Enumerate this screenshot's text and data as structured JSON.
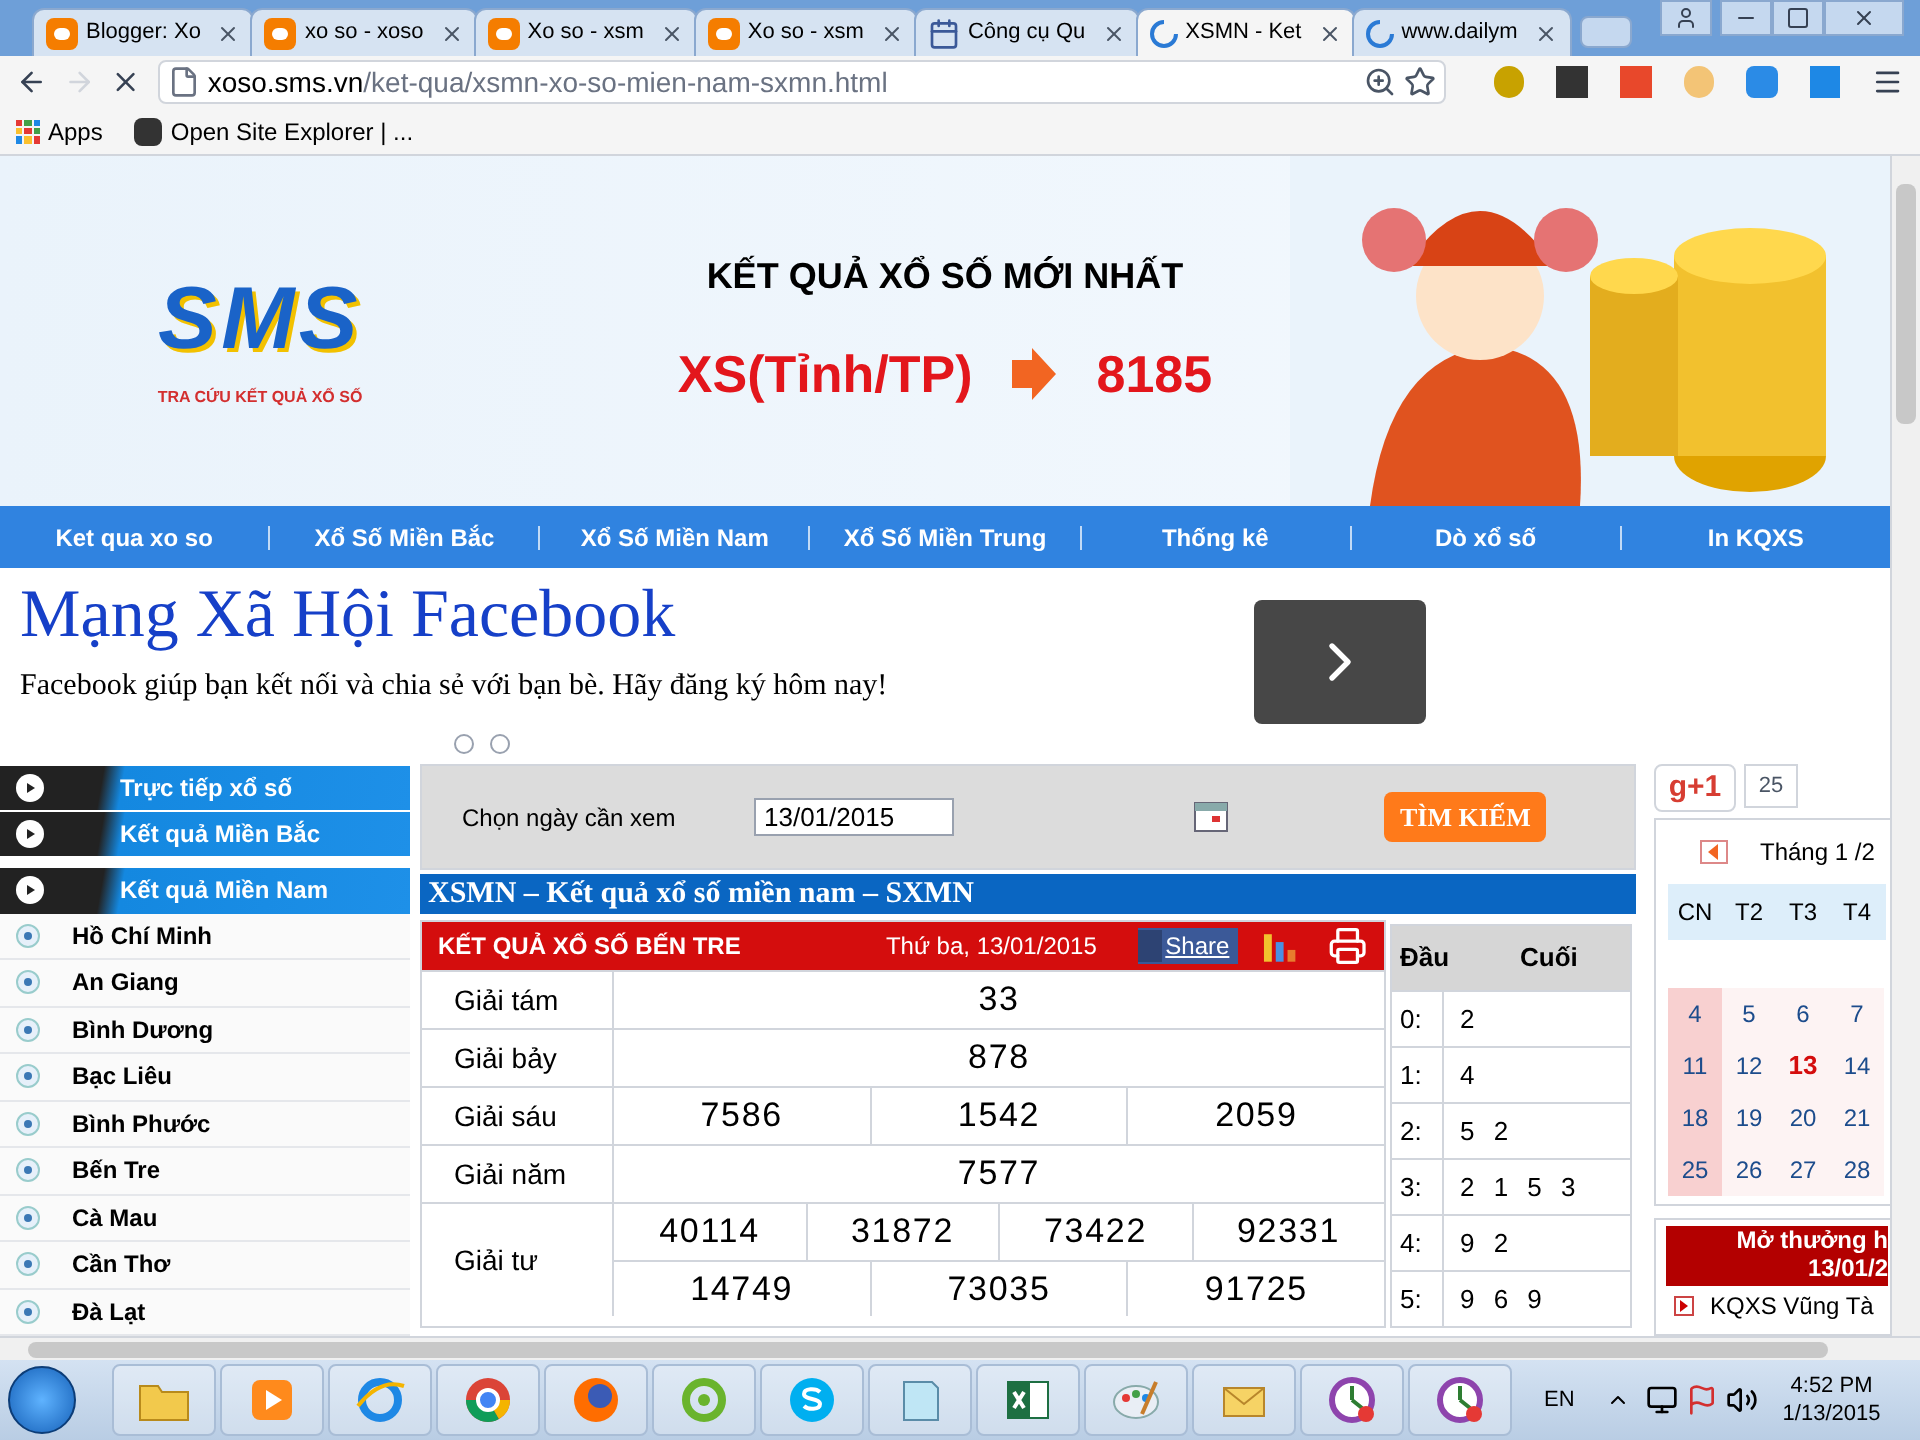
{
  "browser": {
    "tabs": [
      {
        "title": "Blogger: Xo",
        "kind": "blogger",
        "selected": false
      },
      {
        "title": "xo so - xoso",
        "kind": "blogger",
        "selected": false
      },
      {
        "title": "Xo so - xsm",
        "kind": "blogger",
        "selected": false
      },
      {
        "title": "Xo so - xsm",
        "kind": "blogger",
        "selected": false
      },
      {
        "title": "Công cụ Qu",
        "kind": "tool",
        "selected": false
      },
      {
        "title": "XSMN - Ket",
        "kind": "loading",
        "selected": true
      },
      {
        "title": "www.dailym",
        "kind": "loading",
        "selected": false
      }
    ],
    "url_host": "xoso.sms.vn",
    "url_path": "/ket-qua/xsmn-xo-so-mien-nam-sxmn.html",
    "bookmarks": [
      {
        "label": "Apps",
        "kind": "apps"
      },
      {
        "label": "Open Site Explorer | ...",
        "kind": "moz"
      }
    ]
  },
  "banner": {
    "logo": "SMS",
    "tagline": "TRA CỨU KẾT QUẢ XỔ SỐ",
    "headline": "KẾT QUẢ XỔ SỐ MỚI NHẤT",
    "syntax": "XS(Tỉnh/TP)",
    "number": "8185"
  },
  "nav": [
    "Ket qua xo so",
    "Xổ Số Miền Bắc",
    "Xổ Số Miền Nam",
    "Xổ Số Miền Trung",
    "Thống kê",
    "Dò xổ số",
    "In KQXS"
  ],
  "facebook_ad": {
    "title": "Mạng Xã Hội Facebook",
    "text": "Facebook giúp bạn kết nối và chia sẻ với bạn bè. Hãy đăng ký hôm nay!"
  },
  "sidebar": {
    "sections": [
      "Trực tiếp xổ số",
      "Kết quả Miền Bắc",
      "Kết quả Miền Nam"
    ],
    "provinces": [
      "Hồ Chí Minh",
      "An Giang",
      "Bình Dương",
      "Bạc Liêu",
      "Bình Phước",
      "Bến Tre",
      "Cà Mau",
      "Cần Thơ",
      "Đà Lạt"
    ]
  },
  "search": {
    "label": "Chọn ngày cần xem",
    "date": "13/01/2015",
    "button": "TÌM KIẾM"
  },
  "results_title": "XSMN – Kết quả xổ số miền nam – SXMN",
  "results": {
    "title": "KẾT QUẢ XỔ SỐ BẾN TRE",
    "date": "Thứ ba, 13/01/2015",
    "share": "Share",
    "prizes": [
      {
        "name": "Giải tám",
        "lines": [
          [
            "33"
          ]
        ]
      },
      {
        "name": "Giải bảy",
        "lines": [
          [
            "878"
          ]
        ]
      },
      {
        "name": "Giải sáu",
        "lines": [
          [
            "7586",
            "1542",
            "2059"
          ]
        ]
      },
      {
        "name": "Giải năm",
        "lines": [
          [
            "7577"
          ]
        ]
      },
      {
        "name": "Giải tư",
        "lines": [
          [
            "40114",
            "31872",
            "73422",
            "92331"
          ],
          [
            "14749",
            "73035",
            "91725"
          ]
        ]
      }
    ]
  },
  "loto": {
    "columns": [
      "Đầu",
      "Cuối"
    ],
    "rows": [
      {
        "head": "0:",
        "tail": "2"
      },
      {
        "head": "1:",
        "tail": "4"
      },
      {
        "head": "2:",
        "tail": "5 2"
      },
      {
        "head": "3:",
        "tail": "2 1 5 3"
      },
      {
        "head": "4:",
        "tail": "9 2"
      },
      {
        "head": "5:",
        "tail": "9 6 9"
      }
    ]
  },
  "social": {
    "plus": "g+1",
    "count": "25"
  },
  "calendar": {
    "month": "Tháng 1 /2",
    "weekdays": [
      "CN",
      "T2",
      "T3",
      "T4"
    ],
    "weeks": [
      [
        {
          "day": "4",
          "selected": false
        },
        {
          "day": "5",
          "selected": false
        },
        {
          "day": "6",
          "selected": false
        },
        {
          "day": "7",
          "selected": false
        }
      ],
      [
        {
          "day": "11",
          "selected": false
        },
        {
          "day": "12",
          "selected": false
        },
        {
          "day": "13",
          "selected": true
        },
        {
          "day": "14",
          "selected": false
        }
      ],
      [
        {
          "day": "18",
          "selected": false
        },
        {
          "day": "19",
          "selected": false
        },
        {
          "day": "20",
          "selected": false
        },
        {
          "day": "21",
          "selected": false
        }
      ],
      [
        {
          "day": "25",
          "selected": false
        },
        {
          "day": "26",
          "selected": false
        },
        {
          "day": "27",
          "selected": false
        },
        {
          "day": "28",
          "selected": false
        }
      ]
    ]
  },
  "draw_box": {
    "title": "Mở thưởng h",
    "date": "13/01/2",
    "links": [
      "KQXS Vũng Tà"
    ]
  },
  "taskbar": {
    "apps": [
      {
        "kind": "folder"
      },
      {
        "kind": "media"
      },
      {
        "kind": "ie"
      },
      {
        "kind": "chrome"
      },
      {
        "kind": "firefox"
      },
      {
        "kind": "coccoc"
      },
      {
        "kind": "skype"
      },
      {
        "kind": "notepad"
      },
      {
        "kind": "excel"
      },
      {
        "kind": "paint"
      },
      {
        "kind": "mail"
      },
      {
        "kind": "clock"
      },
      {
        "kind": "clock"
      }
    ],
    "language": "EN",
    "time": "4:52 PM",
    "date": "1/13/2015"
  }
}
